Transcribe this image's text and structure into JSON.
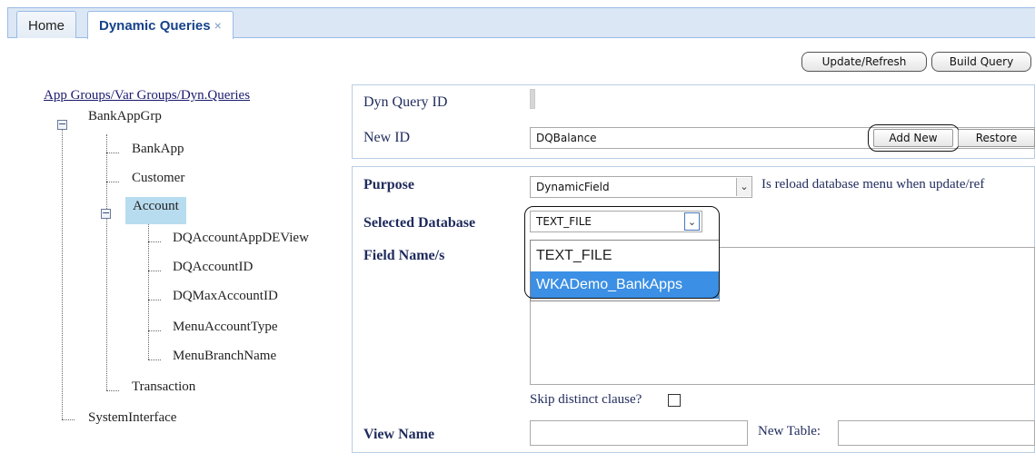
{
  "tabs": [
    {
      "label": "Home"
    },
    {
      "label": "Dynamic Queries",
      "close": "×"
    }
  ],
  "toolbar": {
    "update_label": "Update/Refresh",
    "build_label": "Build Query"
  },
  "tree": {
    "root_link": "App Groups/Var Groups/Dyn.Queries",
    "bank_app_grp": "BankAppGrp",
    "bank_app": "BankApp",
    "customer": "Customer",
    "account": "Account",
    "dq_account_appde_view": "DQAccountAppDEView",
    "dq_account_id": "DQAccountID",
    "dq_max_account_id": "DQMaxAccountID",
    "menu_account_type": "MenuAccountType",
    "menu_branch_name": "MenuBranchName",
    "transaction": "Transaction",
    "system_interface": "SystemInterface"
  },
  "form": {
    "dyn_query_id_label": "Dyn Query ID",
    "dyn_query_id_value": "",
    "new_id_label": "New ID",
    "new_id_value": "DQBalance",
    "add_new_label": "Add New",
    "restore_label": "Restore",
    "purpose_label": "Purpose",
    "purpose_value": "DynamicField",
    "reload_text": "Is reload database menu when update/ref",
    "selected_db_label": "Selected Database",
    "selected_db_value": "TEXT_FILE",
    "db_options": [
      "TEXT_FILE",
      "WKADemo_BankApps"
    ],
    "field_names_label": "Field Name/s",
    "skip_distinct_label": "Skip distinct clause?",
    "view_name_label": "View Name",
    "new_table_label": "New Table:"
  },
  "icons": {
    "select_arrow": "chevron-down-icon",
    "expander": "minus-icon"
  }
}
